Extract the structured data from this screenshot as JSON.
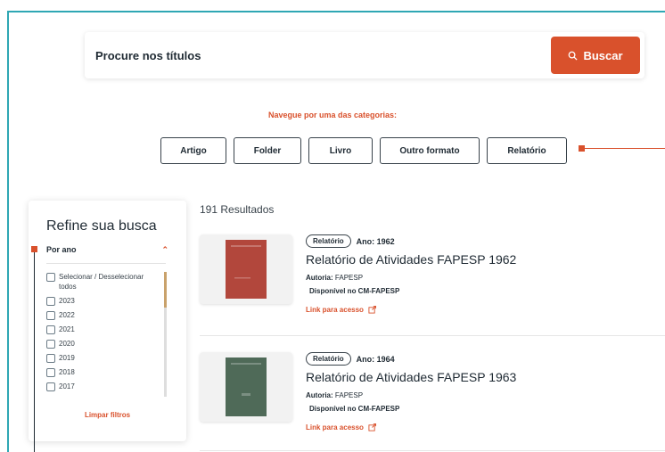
{
  "search": {
    "placeholder": "Procure nos títulos",
    "button_label": "Buscar"
  },
  "categories": {
    "title": "Navegue por uma das categorias:",
    "items": [
      "Artigo",
      "Folder",
      "Livro",
      "Outro formato",
      "Relatório"
    ]
  },
  "sidebar": {
    "title": "Refine sua busca",
    "filter_label": "Por ano",
    "options": [
      "Selecionar / Desselecionar todos",
      "2023",
      "2022",
      "2021",
      "2020",
      "2019",
      "2018",
      "2017"
    ],
    "clear_label": "Limpar filtros"
  },
  "results": {
    "count_text": "191 Resultados",
    "items": [
      {
        "type": "Relatório",
        "year_text": "Ano: 1962",
        "title": "Relatório de Atividades FAPESP 1962",
        "author_label": "Autoria:",
        "author": "FAPESP",
        "availability": "Disponível no CM-FAPESP",
        "link_label": "Link para acesso",
        "cover_color": "#b2473c"
      },
      {
        "type": "Relatório",
        "year_text": "Ano: 1964",
        "title": "Relatório de Atividades FAPESP 1963",
        "author_label": "Autoria:",
        "author": "FAPESP",
        "availability": "Disponível no CM-FAPESP",
        "link_label": "Link para acesso",
        "cover_color": "#4f6a58"
      }
    ]
  },
  "colors": {
    "accent": "#d9512c",
    "frame": "#2fa7b4"
  }
}
